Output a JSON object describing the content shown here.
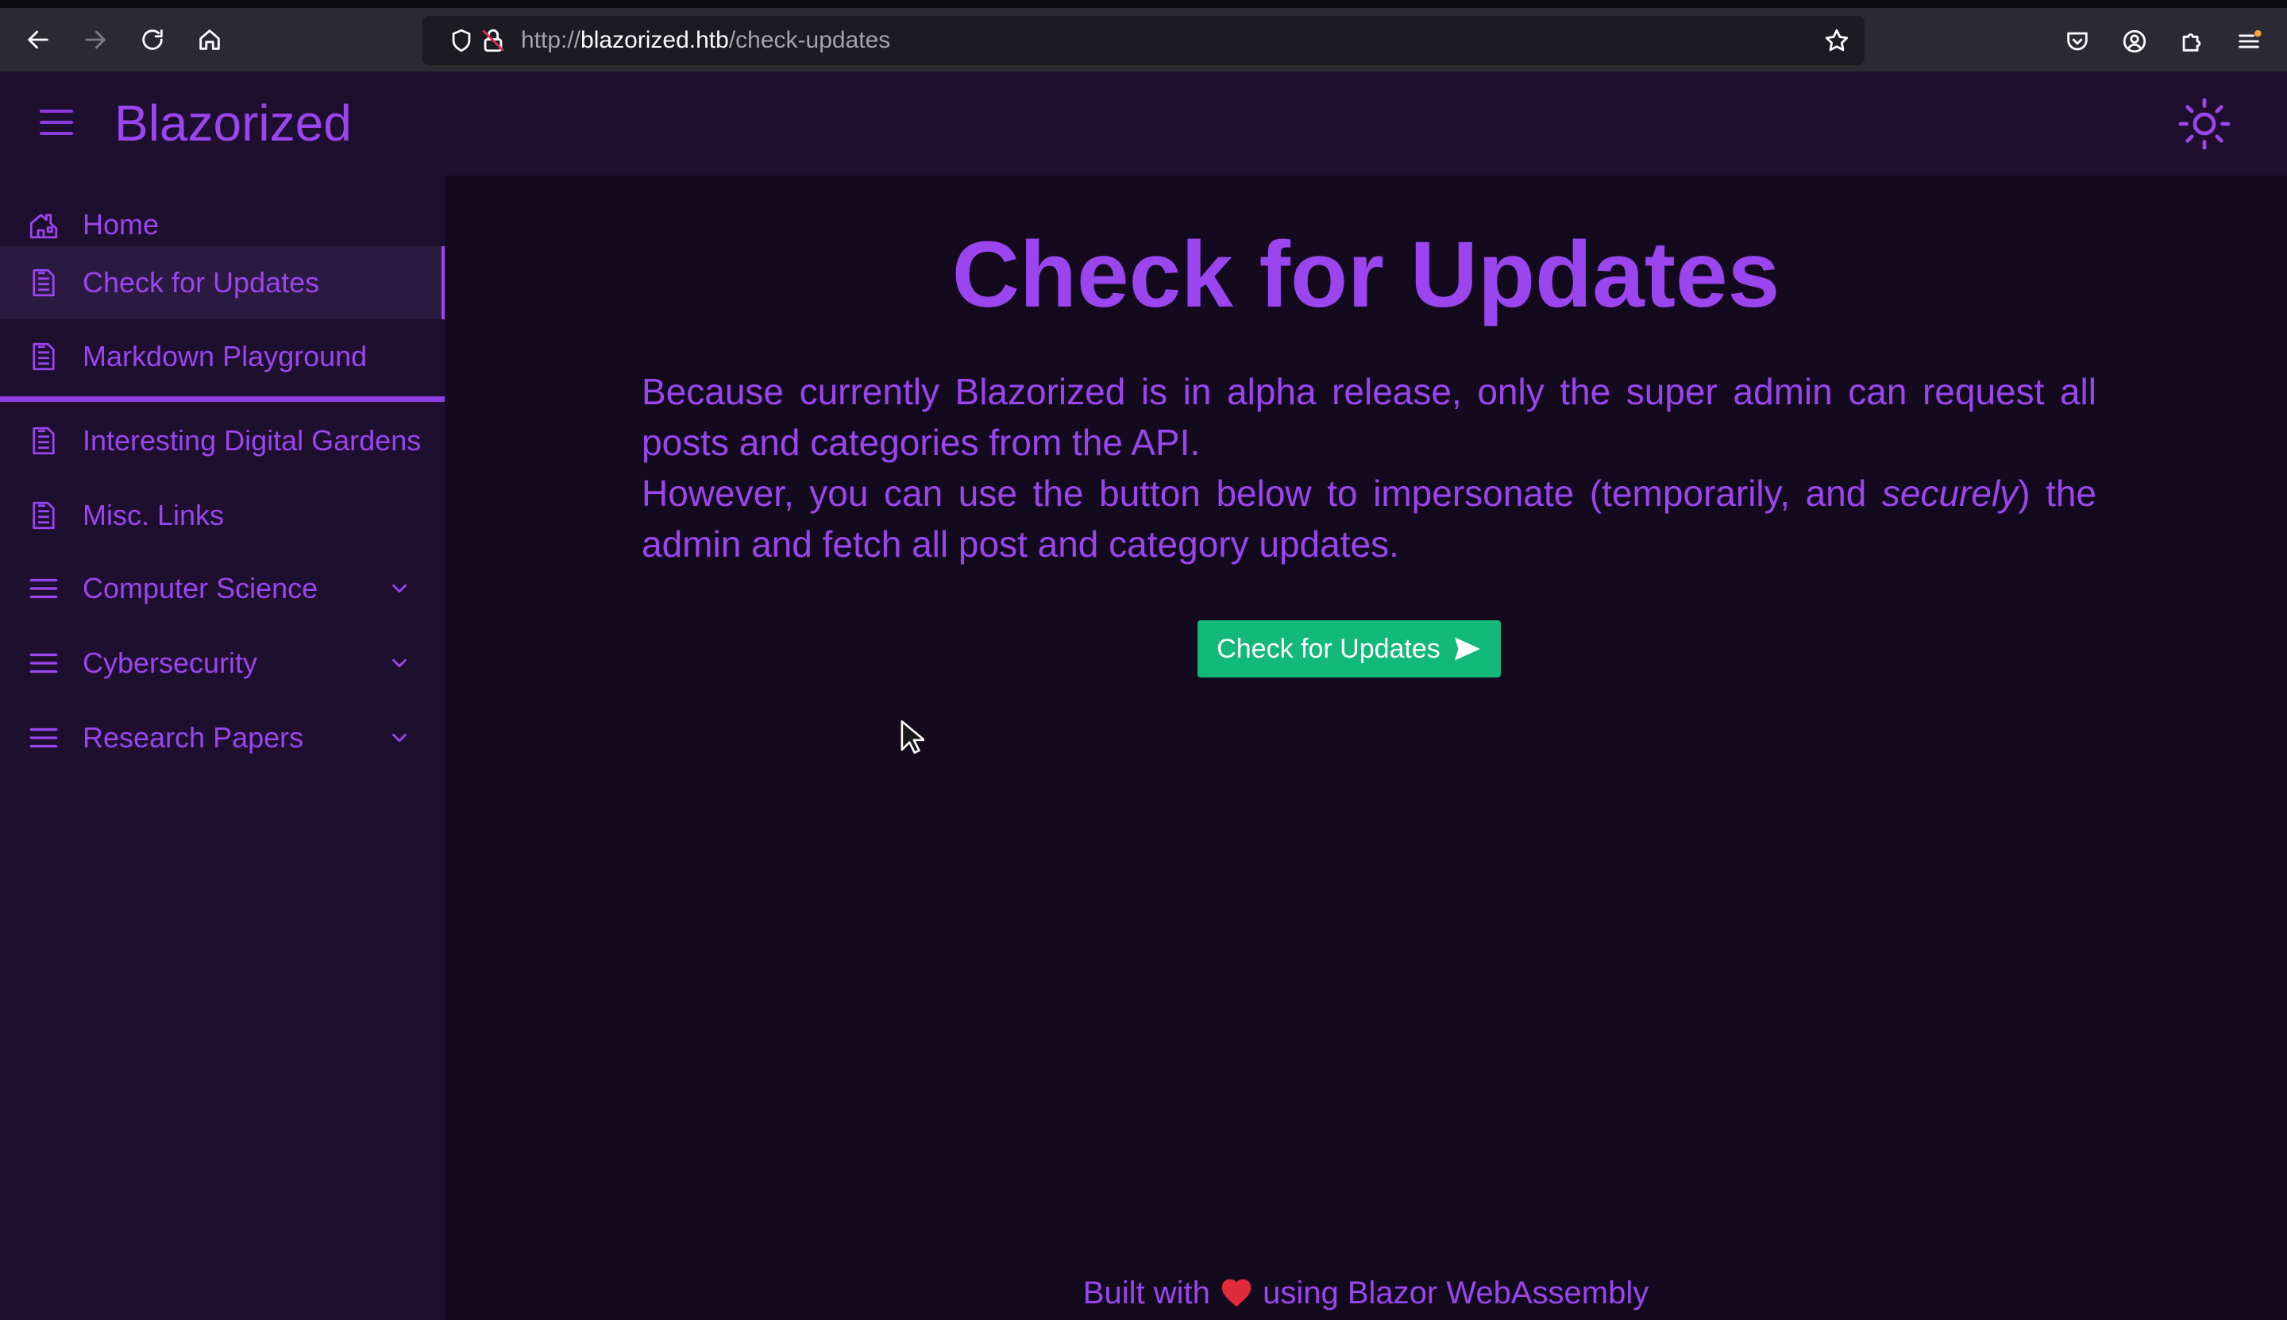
{
  "browser": {
    "url_scheme": "http://",
    "url_host": "blazorized.htb",
    "url_path": "/check-updates"
  },
  "header": {
    "brand": "Blazorized"
  },
  "sidebar": {
    "items": [
      {
        "label": "Home",
        "icon": "home-icon"
      },
      {
        "label": "Check for Updates",
        "icon": "document-icon",
        "active": true
      },
      {
        "label": "Markdown Playground",
        "icon": "document-icon"
      },
      {
        "label": "Interesting Digital Gardens",
        "icon": "document-icon"
      },
      {
        "label": "Misc. Links",
        "icon": "document-icon"
      },
      {
        "label": "Computer Science",
        "icon": "menu-icon",
        "expandable": true
      },
      {
        "label": "Cybersecurity",
        "icon": "menu-icon",
        "expandable": true
      },
      {
        "label": "Research Papers",
        "icon": "menu-icon",
        "expandable": true
      }
    ]
  },
  "main": {
    "title": "Check for Updates",
    "para1": "Because currently Blazorized is in alpha release, only the super admin can request all posts and categories from the API.",
    "para2_before": "However, you can use the button below to impersonate (temporarily, and ",
    "para2_emph": "securely",
    "para2_after": ") the admin and fetch all post and category updates.",
    "button_label": "Check for Updates"
  },
  "footer": {
    "before": "Built with",
    "after": "using Blazor WebAssembly"
  },
  "colors": {
    "accent": "#9a45ee",
    "sidebar_bg": "#1e0f2e",
    "main_bg": "#140a1e",
    "button_bg": "#13b97a",
    "heart": "#e02b3a"
  }
}
